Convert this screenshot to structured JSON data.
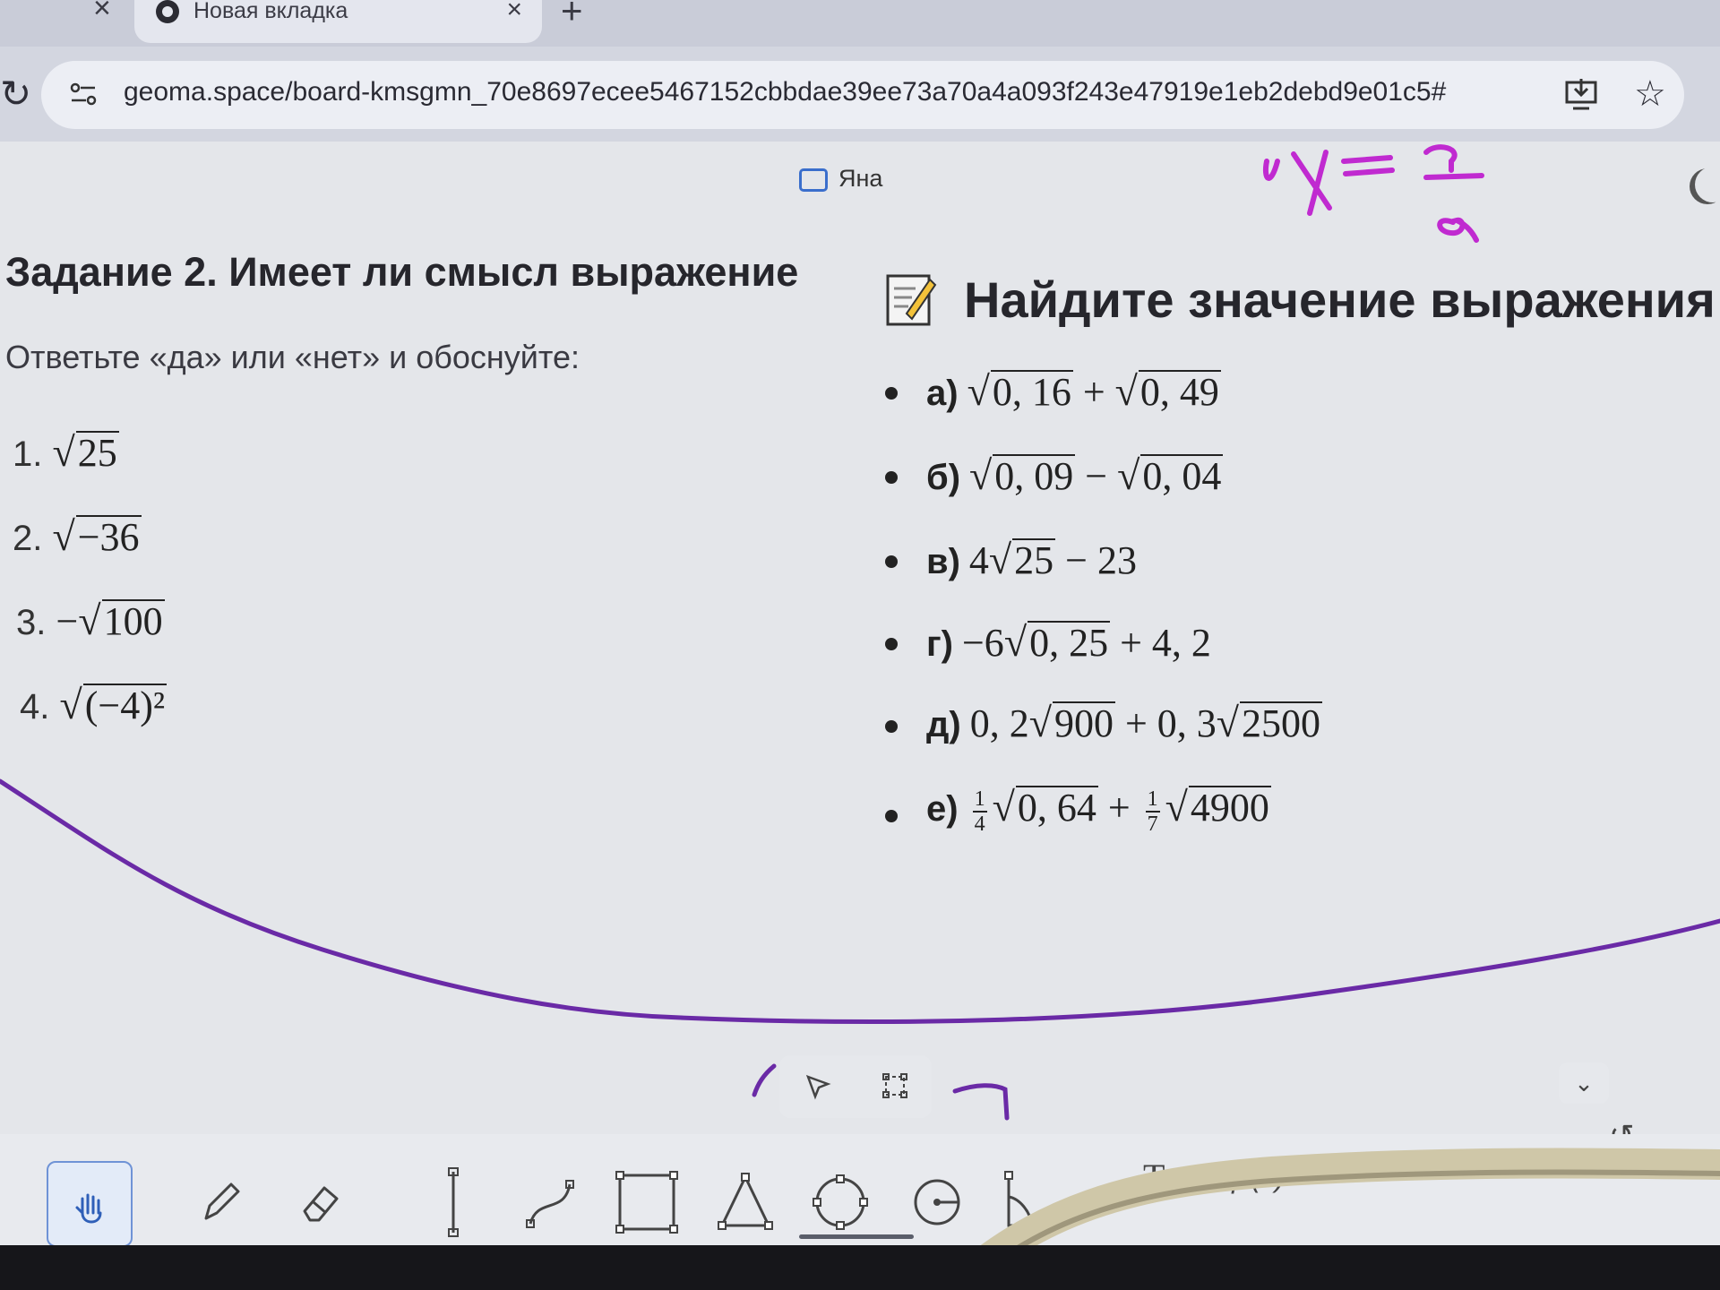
{
  "browser": {
    "tab_title": "Новая вкладка",
    "url": "geoma.space/board-kmsgmn_70e8697ecee5467152cbbdae39ee73a70a4a093f243e47919e1eb2debd9e01c5#"
  },
  "board": {
    "user_label": "Яна",
    "handwriting_color": "#c02ad0",
    "stroke_color": "#6a2aa6"
  },
  "task2": {
    "title": "Задание 2. Имеет ли смысл выражение",
    "subtitle": "Ответьте «да» или «нет» и обоснуйте:",
    "items": [
      {
        "num": "1.",
        "pre": "",
        "radicand": "25",
        "post": ""
      },
      {
        "num": "2.",
        "pre": "",
        "radicand": "−36",
        "post": ""
      },
      {
        "num": "3.",
        "pre": "−",
        "radicand": "100",
        "post": ""
      },
      {
        "num": "4.",
        "pre": "",
        "radicand": "(−4)²",
        "post": ""
      }
    ]
  },
  "task_find": {
    "title": "Найдите значение выражения:",
    "items": [
      {
        "letter": "а)",
        "parts": [
          "",
          "0, 16",
          " + ",
          "0, 49",
          ""
        ]
      },
      {
        "letter": "б)",
        "parts": [
          "",
          "0, 09",
          " − ",
          "0, 04",
          ""
        ]
      },
      {
        "letter": "в)",
        "parts": [
          "4",
          "25",
          " − 23"
        ]
      },
      {
        "letter": "г)",
        "parts": [
          "−6",
          "0, 25",
          " + 4, 2"
        ]
      },
      {
        "letter": "д)",
        "parts": [
          "0, 2",
          "900",
          " + 0, 3",
          "2500",
          ""
        ]
      },
      {
        "letter": "е)",
        "frac1": {
          "num": "1",
          "den": "4"
        },
        "rad1": "0, 64",
        "plus": " + ",
        "frac2": {
          "num": "1",
          "den": "7"
        },
        "rad2": "4900"
      }
    ]
  },
  "toolbar": {
    "text_tool": "T",
    "function_tool": "ƒ (x)"
  }
}
